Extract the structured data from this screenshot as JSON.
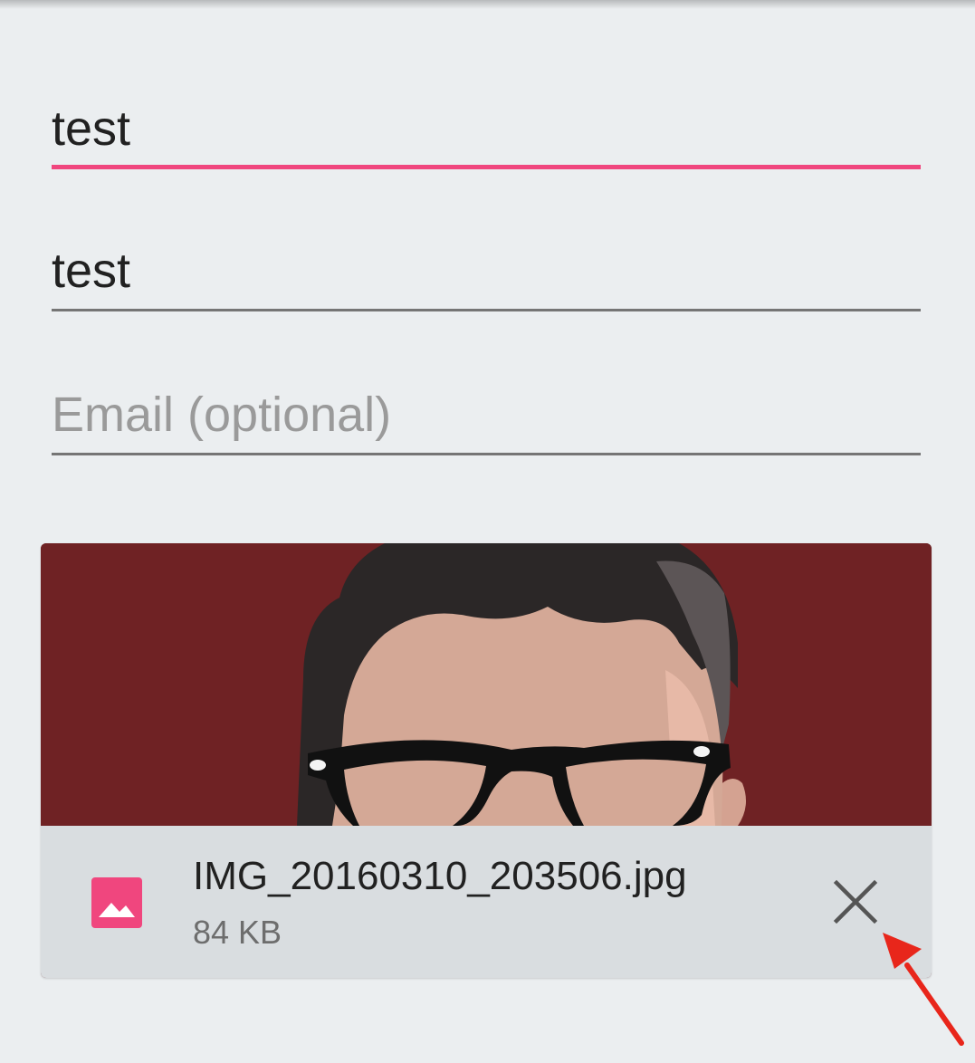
{
  "form": {
    "field_1": {
      "value": "test"
    },
    "field_2": {
      "value": "test"
    },
    "email": {
      "value": "",
      "placeholder": "Email (optional)"
    }
  },
  "attachment": {
    "preview": "image-preview",
    "file_name": "IMG_20160310_203506.jpg",
    "file_size": "84 KB",
    "file_icon": "image-icon",
    "remove_icon": "close-icon"
  },
  "annotation": {
    "arrow_icon": "red-arrow-icon",
    "arrow_color": "#e8261b"
  },
  "colors": {
    "accent": "#f0467e",
    "background": "#ebeef0",
    "file_bar": "#d9dde0",
    "preview_bg": "#6f2224"
  }
}
